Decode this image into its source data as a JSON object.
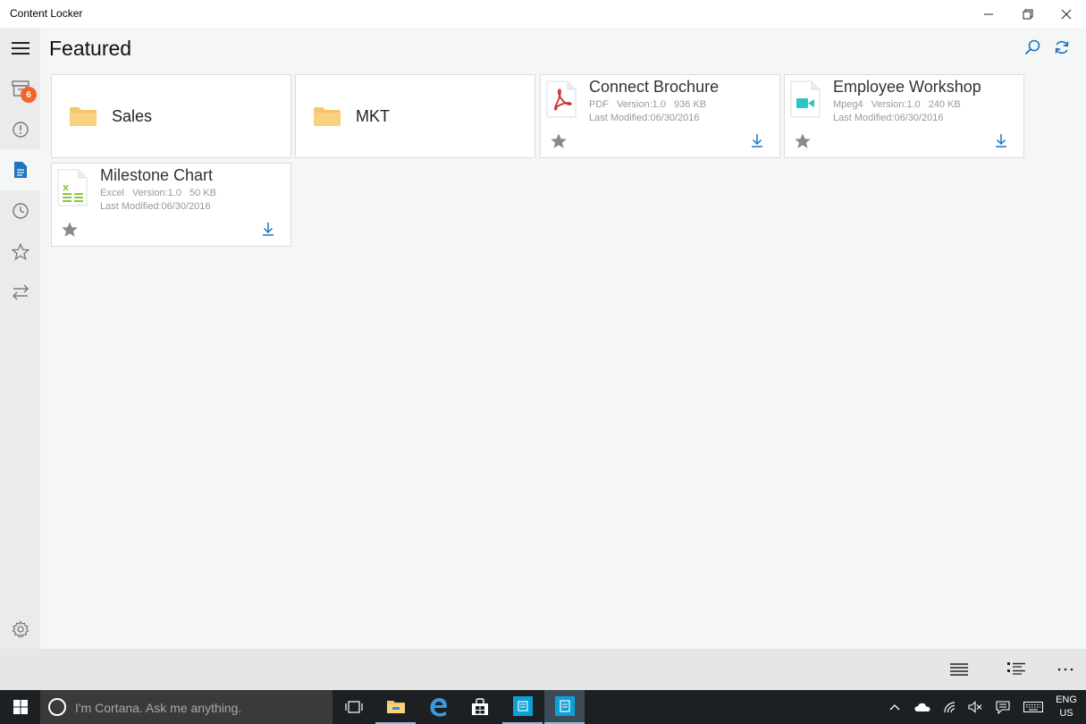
{
  "window": {
    "title": "Content Locker"
  },
  "header": {
    "title": "Featured"
  },
  "sidebar": {
    "notification_count": "6"
  },
  "folders": [
    {
      "name": "Sales"
    },
    {
      "name": "MKT"
    }
  ],
  "documents": [
    {
      "name": "Connect Brochure",
      "type": "PDF",
      "version": "Version:1.0",
      "size": "936 KB",
      "modified": "Last Modified:06/30/2016",
      "icon": "pdf-file-icon"
    },
    {
      "name": "Employee Workshop",
      "type": "Mpeg4",
      "version": "Version:1.0",
      "size": "240 KB",
      "modified": "Last Modified:06/30/2016",
      "icon": "video-file-icon"
    },
    {
      "name": "Milestone Chart",
      "type": "Excel",
      "version": "Version:1.0",
      "size": "50 KB",
      "modified": "Last Modified:06/30/2016",
      "icon": "excel-file-icon"
    }
  ],
  "taskbar": {
    "search_placeholder": "I'm Cortana. Ask me anything.",
    "lang_line1": "ENG",
    "lang_line2": "US"
  },
  "colors": {
    "accent": "#1e73be",
    "badge": "#f0662a",
    "folder": "#f5c56a",
    "pdf": "#c9302c",
    "video": "#2ec4c4",
    "excel": "#8cc63f"
  }
}
